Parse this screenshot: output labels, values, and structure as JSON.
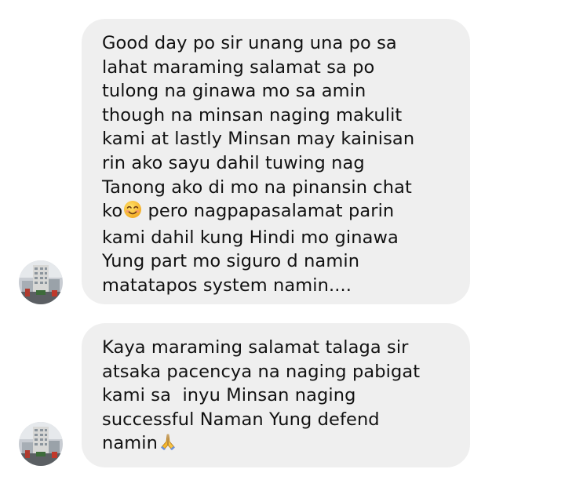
{
  "colors": {
    "bubble_background": "#efefef",
    "text": "#111111",
    "page_background": "#ffffff"
  },
  "messages": [
    {
      "lines": [
        "Good day po sir unang una po sa",
        "lahat maraming salamat sa po",
        "tulong na ginawa mo sa amin",
        "though na minsan naging makulit",
        "kami at lastly Minsan may kainisan",
        "rin ako sayu dahil tuwing nag",
        "Tanong ako di mo na pinansin chat",
        "ko",
        " pero nagpapasalamat parin",
        "kami dahil kung Hindi mo ginawa",
        "Yung part mo siguro d namin",
        "matatapos system namin...."
      ],
      "emoji": "smiling-face-emoji",
      "avatar_icon": "sender-avatar-building-photo"
    },
    {
      "lines": [
        "Kaya maraming salamat talaga sir",
        "atsaka pacencya na naging pabigat",
        "kami sa  inyu Minsan naging",
        "successful Naman Yung defend",
        "namin"
      ],
      "emoji": "folded-hands-emoji",
      "avatar_icon": "sender-avatar-building-photo"
    }
  ]
}
